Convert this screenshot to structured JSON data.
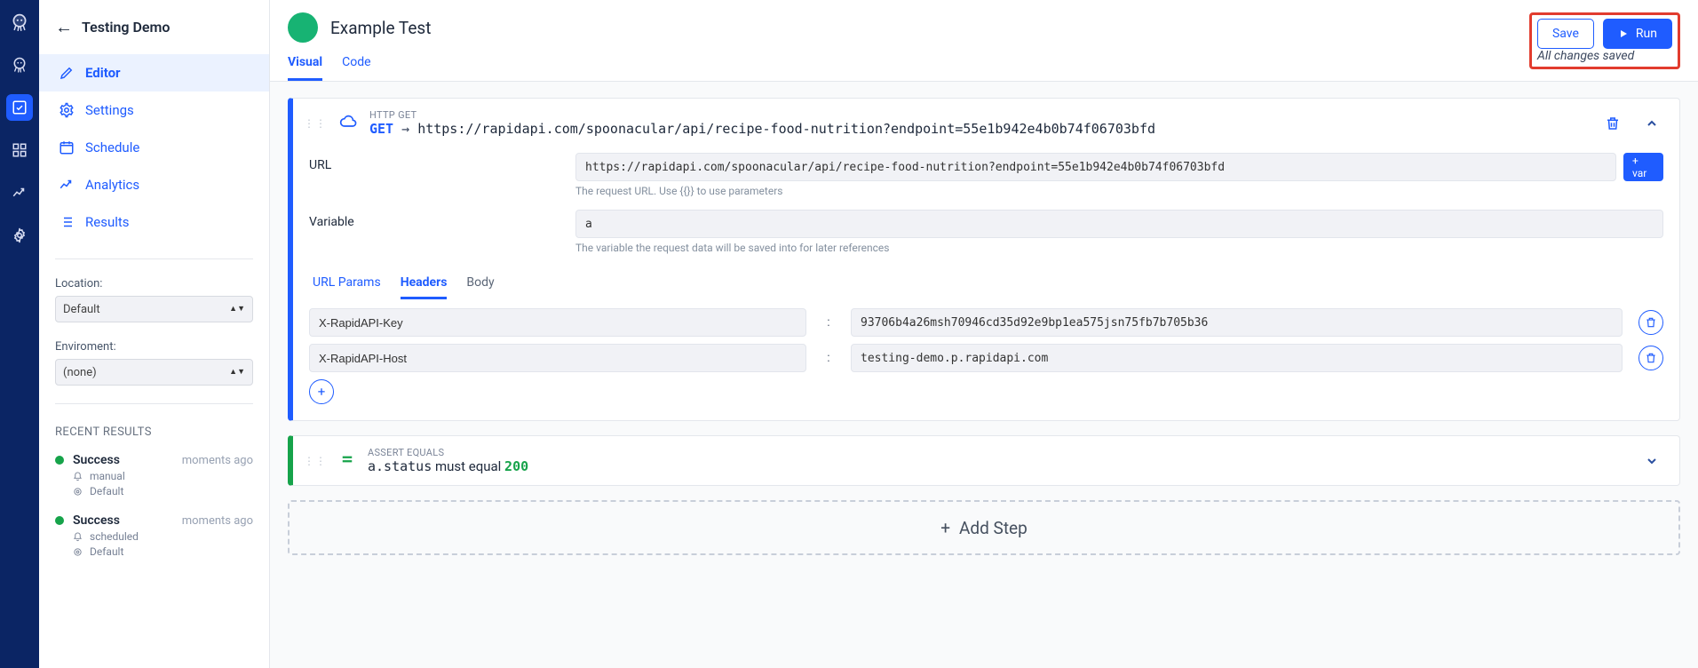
{
  "sidebar": {
    "title": "Testing Demo",
    "nav": {
      "editor": "Editor",
      "settings": "Settings",
      "schedule": "Schedule",
      "analytics": "Analytics",
      "results": "Results"
    },
    "location_label": "Location:",
    "location_value": "Default",
    "environment_label": "Enviroment:",
    "environment_value": "(none)",
    "recent_title": "RECENT RESULTS",
    "recent": [
      {
        "status": "Success",
        "time": "moments ago",
        "trigger": "manual",
        "loc": "Default"
      },
      {
        "status": "Success",
        "time": "moments ago",
        "trigger": "scheduled",
        "loc": "Default"
      }
    ]
  },
  "topbar": {
    "test_title": "Example Test",
    "tab_visual": "Visual",
    "tab_code": "Code",
    "save_label": "Save",
    "run_label": "Run",
    "saved_text": "All changes saved"
  },
  "step_http": {
    "kicker": "HTTP GET",
    "method": "GET",
    "arrow": "→",
    "url_display": "https://rapidapi.com/spoonacular/api/recipe-food-nutrition?endpoint=55e1b942e4b0b74f06703bfd",
    "url_label": "URL",
    "url_value": "https://rapidapi.com/spoonacular/api/recipe-food-nutrition?endpoint=55e1b942e4b0b74f06703bfd",
    "url_hint": "The request URL. Use {{}} to use parameters",
    "var_label": "Variable",
    "var_value": "a",
    "var_hint": "The variable the request data will be saved into for later references",
    "addvar_label": "+ var",
    "subtabs": {
      "params": "URL Params",
      "headers": "Headers",
      "body": "Body"
    },
    "headers": [
      {
        "key": "X-RapidAPI-Key",
        "value": "93706b4a26msh70946cd35d92e9bp1ea575jsn75fb7b705b36"
      },
      {
        "key": "X-RapidAPI-Host",
        "value": "testing-demo.p.rapidapi.com"
      }
    ]
  },
  "step_assert": {
    "kicker": "ASSERT EQUALS",
    "expr": "a.status",
    "mid": " must equal ",
    "val": "200"
  },
  "add_step_label": "Add Step"
}
